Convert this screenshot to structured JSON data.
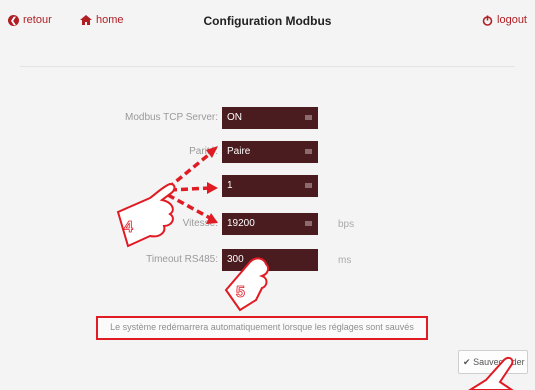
{
  "header": {
    "back_label": "retour",
    "home_label": "home",
    "title": "Configuration Modbus",
    "logout_label": "logout",
    "accent_color": "#b01f24"
  },
  "form": {
    "modbus_tcp": {
      "label": "Modbus TCP Server:",
      "value": "ON"
    },
    "parity": {
      "label": "Parité:",
      "value": "Paire"
    },
    "stop_bits": {
      "label": "",
      "value": "1"
    },
    "speed": {
      "label": "Vitesse:",
      "value": "19200",
      "unit": "bps"
    },
    "timeout": {
      "label": "Timeout RS485:",
      "value": "300",
      "unit": "ms"
    }
  },
  "notice": "Le système redémarrera automatiquement lorsque les réglages sont sauvés",
  "save_label": "Sauvegarder",
  "callouts": {
    "step_a": "4",
    "step_b": "5"
  },
  "colors": {
    "field_bg": "#4a1c1f",
    "highlight": "#e01b24"
  }
}
